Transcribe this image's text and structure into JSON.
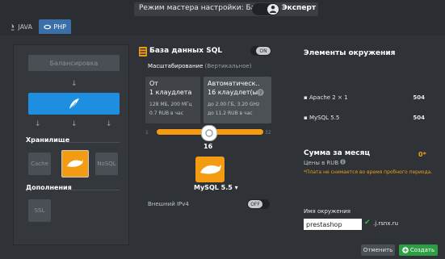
{
  "topbar": {
    "mode_label": "Режим мастера настройки: Базовый",
    "expert_label": "Эксперт"
  },
  "tabs": [
    {
      "label": "JAVA"
    },
    {
      "label": "PHP"
    }
  ],
  "left": {
    "balancer_label": "Балансировка",
    "storage_title": "Хранилище",
    "storage_items": {
      "cache": "Cache",
      "mysql": "MySQL",
      "nosql": "NoSQL"
    },
    "addons_title": "Дополнения",
    "ssl_label": "SSL"
  },
  "center": {
    "db_title": "База данных SQL",
    "db_toggle": "ON",
    "scale_label": "Масштабирование",
    "scale_label_dim": "(Вертикальное)",
    "from_box": {
      "title": "От",
      "count": "1 клаудлета",
      "spec": "128 МБ, 200 МГц",
      "price": "0.7 RUB в час"
    },
    "auto_box": {
      "title": "Автоматическ..",
      "count": "16 клаудлет(ы)",
      "spec_prefix": "до",
      "spec": "2.00 ГБ, 3.20 GHz",
      "price_prefix": "до",
      "price": "11.2 RUB в час"
    },
    "slider": {
      "min": 1,
      "value": 16,
      "max": 32
    },
    "node_count": "16",
    "node_name": "MySQL 5.5",
    "ipv4_label": "Внешний IPv4",
    "ipv4_toggle": "OFF"
  },
  "right": {
    "env_elements_title": "Элементы окружения",
    "items": [
      {
        "label": "",
        "value": "",
        "faded": true
      },
      {
        "label": "",
        "value": "",
        "faded": true
      },
      {
        "label": "",
        "value": "",
        "faded": true
      },
      {
        "label": "Apache 2 × 1",
        "value": "504",
        "faded": false
      },
      {
        "label": "",
        "value": "",
        "faded": true
      },
      {
        "label": "MySQL 5.5",
        "value": "504",
        "faded": false
      },
      {
        "label": "",
        "value": "",
        "faded": true
      },
      {
        "label": "",
        "value": "",
        "faded": true
      }
    ],
    "sum_title": "Сумма за месяц",
    "sum_value": "0*",
    "sum_currency": "Цены в RUB",
    "sum_note": "*Плата не снимается во время пробного периода.",
    "env_name_label": "Имя окружения",
    "env_name_value": "prestashop",
    "env_domain": ".j.rsnx.ru",
    "cancel_label": "Отменить",
    "create_label": "Создать"
  },
  "colors": {
    "accent_blue": "#1e8ee0",
    "accent_orange": "#f39c12",
    "create_green": "#2e9e44",
    "background": "#2f3338"
  }
}
